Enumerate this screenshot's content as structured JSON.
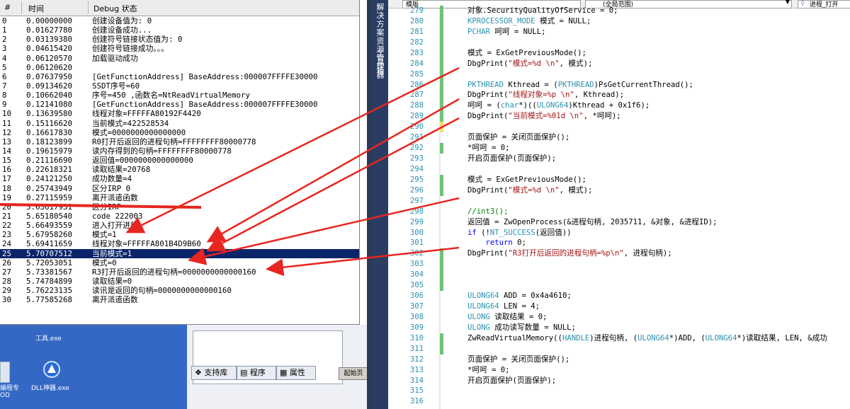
{
  "debugview": {
    "headers": {
      "num": "#",
      "time": "时间",
      "status": "Debug 状态"
    },
    "rows": [
      {
        "n": "0",
        "t": "0.00000000",
        "s": "创建设备值为: 0"
      },
      {
        "n": "1",
        "t": "0.01627780",
        "s": "创建设备成功..."
      },
      {
        "n": "2",
        "t": "0.03139380",
        "s": "创建符号链接状态值为: 0"
      },
      {
        "n": "3",
        "t": "0.04615420",
        "s": "创建符号链接成功。。。"
      },
      {
        "n": "4",
        "t": "0.06120570",
        "s": "加载驱动成功"
      },
      {
        "n": "5",
        "t": "0.06120620",
        "s": ""
      },
      {
        "n": "6",
        "t": "0.07637950",
        "s": "[GetFunctionAddress] BaseAddress:000007FFFFE30000"
      },
      {
        "n": "7",
        "t": "0.09134620",
        "s": "SSDT序号=60"
      },
      {
        "n": "8",
        "t": "0.10662040",
        "s": "序号=450 ,函数名=NtReadVirtualMemory"
      },
      {
        "n": "9",
        "t": "0.12141080",
        "s": "[GetFunctionAddress] BaseAddress:000007FFFFE30000"
      },
      {
        "n": "10",
        "t": "0.13639580",
        "s": "线程对象=FFFFFA80192F4420"
      },
      {
        "n": "11",
        "t": "0.15116620",
        "s": "当前模式=422528534"
      },
      {
        "n": "12",
        "t": "0.16617830",
        "s": "模式=0000000000000000"
      },
      {
        "n": "13",
        "t": "0.18123899",
        "s": "R0打开后返回的进程句柄=FFFFFFFF80000778"
      },
      {
        "n": "14",
        "t": "0.19615979",
        "s": "读内存得到的句柄=FFFFFFFF80000778"
      },
      {
        "n": "15",
        "t": "0.21116690",
        "s": "返回值=0000000000000000"
      },
      {
        "n": "16",
        "t": "0.22618321",
        "s": "读取结果=20768"
      },
      {
        "n": "17",
        "t": "0.24121250",
        "s": "成功数量=4"
      },
      {
        "n": "18",
        "t": "0.25743949",
        "s": "区分IRP 0"
      },
      {
        "n": "19",
        "t": "0.27115959",
        "s": "离开派遣函数"
      },
      {
        "n": "20",
        "t": "5.63617931",
        "s": "区分IRP"
      },
      {
        "n": "21",
        "t": "5.65180540",
        "s": "code  222003"
      },
      {
        "n": "22",
        "t": "5.66493559",
        "s": "进入打开进程"
      },
      {
        "n": "23",
        "t": "5.67958260",
        "s": "模式=1"
      },
      {
        "n": "24",
        "t": "5.69411659",
        "s": "线程对象=FFFFFA801B4D9B60"
      },
      {
        "n": "25",
        "t": "5.70707512",
        "s": "当前模式=1",
        "selected": true
      },
      {
        "n": "26",
        "t": "5.72053051",
        "s": "模式=0"
      },
      {
        "n": "27",
        "t": "5.73381567",
        "s": "R3打开后返回的进程句柄=0000000000000160"
      },
      {
        "n": "28",
        "t": "5.74784899",
        "s": "读取结果=0"
      },
      {
        "n": "29",
        "t": "5.76223135",
        "s": "读讯是返回的句柄=0000000000000160"
      },
      {
        "n": "30",
        "t": "5.77585268",
        "s": "离开派遣函数"
      }
    ]
  },
  "desktop": {
    "tool_exe": "工具.exe",
    "dll_exe": "DLL神器.exe",
    "partial_label": "编程专",
    "partial_label2": "OD"
  },
  "vs_panel": {
    "tabs": [
      "支持库",
      "程序",
      "属性"
    ],
    "start_label": "起始页"
  },
  "sidebar": {
    "solution_explorer": "解决方案资源管理器",
    "toolbox": "工具箱"
  },
  "editor": {
    "scope_dropdown": "(全局范围)",
    "left_dropdown": "模版",
    "right_dropdown": "进程_打开",
    "lines": [
      {
        "n": "279",
        "code": "对象.SecurityQualityOfService = 0;",
        "mark": "green"
      },
      {
        "n": "280",
        "code": "KPROCESSOR_MODE 模式 = NULL;",
        "mark": "green"
      },
      {
        "n": "281",
        "code": "PCHAR 呵呵 = NULL;",
        "mark": "green"
      },
      {
        "n": "282",
        "code": "",
        "mark": "green"
      },
      {
        "n": "283",
        "code": "模式 = ExGetPreviousMode();",
        "mark": "green"
      },
      {
        "n": "284",
        "code": "DbgPrint(\"模式=%d \\n\", 模式);",
        "mark": "green"
      },
      {
        "n": "285",
        "code": "",
        "mark": "green"
      },
      {
        "n": "286",
        "code": "PKTHREAD Kthread = (PKTHREAD)PsGetCurrentThread();",
        "mark": "green"
      },
      {
        "n": "287",
        "code": "DbgPrint(\"线程对象=%p \\n\", Kthread);",
        "mark": "green"
      },
      {
        "n": "288",
        "code": "呵呵 = (char*)((ULONG64)Kthread + 0x1f6);",
        "mark": "green"
      },
      {
        "n": "289",
        "code": "DbgPrint(\"当前模式=%01d \\n\", *呵呵);",
        "mark": "green"
      },
      {
        "n": "290",
        "code": "",
        "mark": "yellow"
      },
      {
        "n": "291",
        "code": "页面保护 = 关闭页面保护();",
        "mark": ""
      },
      {
        "n": "292",
        "code": "*呵呵 = 0;",
        "mark": "green"
      },
      {
        "n": "293",
        "code": "开启页面保护(页面保护);",
        "mark": ""
      },
      {
        "n": "294",
        "code": "",
        "mark": ""
      },
      {
        "n": "295",
        "code": "模式 = ExGetPreviousMode();",
        "mark": "green"
      },
      {
        "n": "296",
        "code": "DbgPrint(\"模式=%d \\n\", 模式);",
        "mark": "green"
      },
      {
        "n": "297",
        "code": "",
        "mark": ""
      },
      {
        "n": "298",
        "code": "//int3();",
        "mark": ""
      },
      {
        "n": "299",
        "code": "返回值 = ZwOpenProcess(&进程句柄, 2035711, &对象, &进程ID);",
        "mark": ""
      },
      {
        "n": "300",
        "code": "if (!NT_SUCCESS(返回值))",
        "mark": ""
      },
      {
        "n": "301",
        "code": "    return 0;",
        "mark": ""
      },
      {
        "n": "302",
        "code": "DbgPrint(\"R3打开后返回的进程句柄=%p\\n\", 进程句柄);",
        "mark": "green"
      },
      {
        "n": "303",
        "code": "",
        "mark": "green"
      },
      {
        "n": "304",
        "code": "",
        "mark": "green"
      },
      {
        "n": "305",
        "code": "",
        "mark": "green"
      },
      {
        "n": "306",
        "code": "ULONG64 ADD = 0x4a4610;",
        "mark": ""
      },
      {
        "n": "307",
        "code": "ULONG64 LEN = 4;",
        "mark": ""
      },
      {
        "n": "308",
        "code": "ULONG 读取结果 = 0;",
        "mark": ""
      },
      {
        "n": "309",
        "code": "ULONG 成功读写数量 = NULL;",
        "mark": ""
      },
      {
        "n": "310",
        "code": "ZwReadVirtualMemory((HANDLE)进程句柄, (ULONG64*)ADD, (ULONG64*)读取结果, LEN, &成功",
        "mark": "green"
      },
      {
        "n": "311",
        "code": "",
        "mark": "green"
      },
      {
        "n": "312",
        "code": "页面保护 = 关闭页面保护();",
        "mark": ""
      },
      {
        "n": "313",
        "code": "*呵呵 = 0;",
        "mark": ""
      },
      {
        "n": "314",
        "code": "开启页面保护(页面保护);",
        "mark": ""
      },
      {
        "n": "315",
        "code": "",
        "mark": ""
      },
      {
        "n": "316",
        "code": "",
        "mark": ""
      }
    ]
  },
  "colors": {
    "arrow": "#e8251f",
    "selection": "#0a246a",
    "sidebar": "#2b3c63"
  }
}
